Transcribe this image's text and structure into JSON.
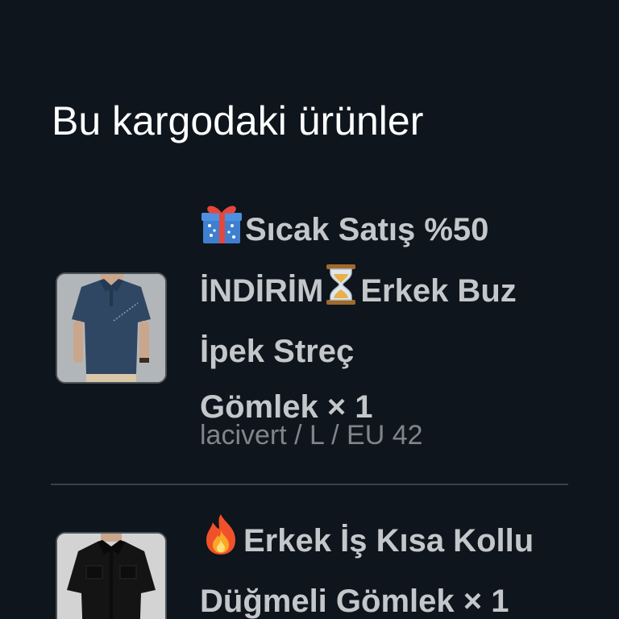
{
  "section": {
    "title": "Bu kargodaki ürünler"
  },
  "items": [
    {
      "title_lines": [
        "Sıcak Satış %50",
        "İNDİRİM",
        "Erkek Buz",
        "İpek Streç",
        "Gömlek × 1"
      ],
      "variant": "lacivert / L / EU 42",
      "icons": [
        "gift-icon",
        "hourglass-icon"
      ],
      "thumbnail": "navy-polo-shirt-image"
    },
    {
      "title_lines": [
        "Erkek İş Kısa Kollu",
        "Düğmeli Gömlek × 1"
      ],
      "icons": [
        "fire-icon"
      ],
      "thumbnail": "black-button-shirt-image"
    }
  ]
}
